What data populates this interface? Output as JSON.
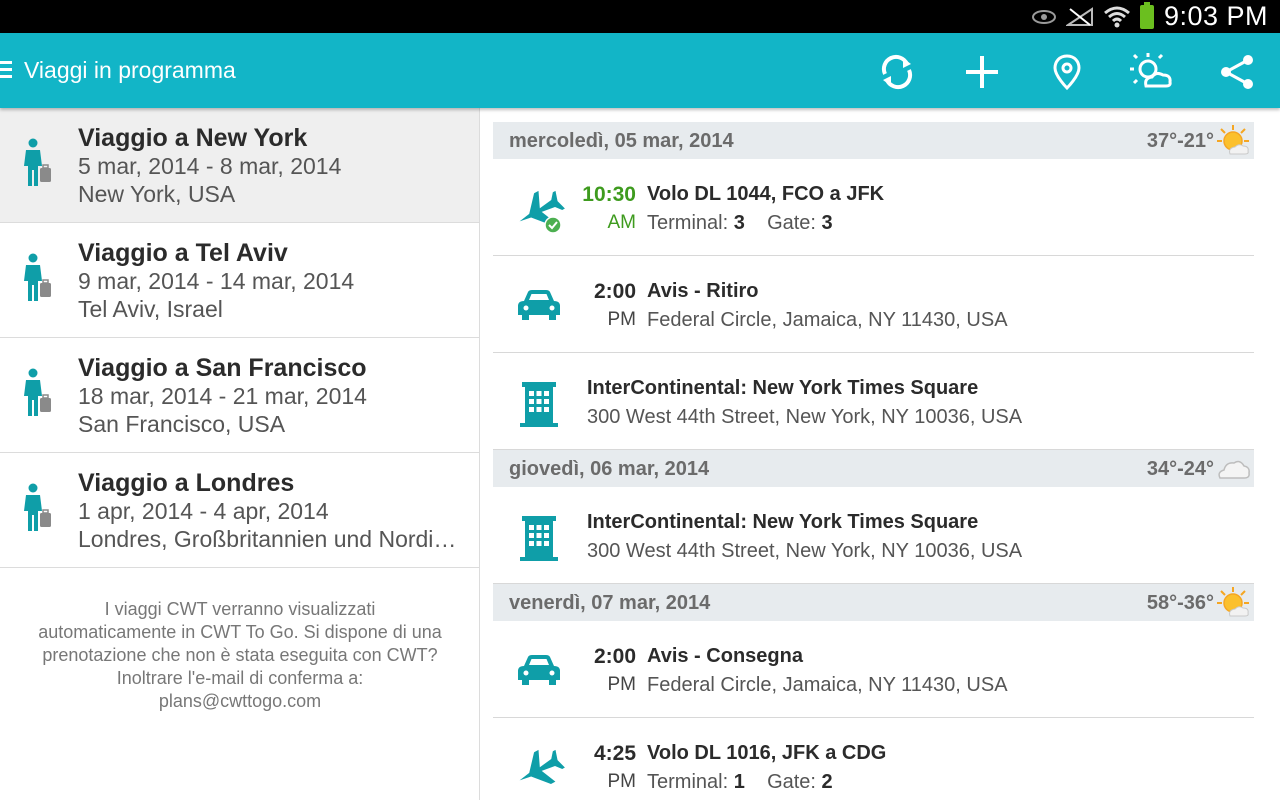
{
  "status_bar": {
    "time": "9:03 PM"
  },
  "action_bar": {
    "title": "Viaggi in programma",
    "actions": [
      "refresh-icon",
      "add-icon",
      "location-pin-icon",
      "weather-icon",
      "share-icon"
    ]
  },
  "trips": [
    {
      "name": "Viaggio a New York",
      "dates": "5 mar, 2014 - 8 mar, 2014",
      "place": "New York, USA"
    },
    {
      "name": "Viaggio a Tel Aviv",
      "dates": "9 mar, 2014 - 14 mar, 2014",
      "place": "Tel Aviv, Israel"
    },
    {
      "name": "Viaggio a San Francisco",
      "dates": "18 mar, 2014 - 21 mar, 2014",
      "place": "San Francisco, USA"
    },
    {
      "name": "Viaggio a Londres",
      "dates": "1 apr, 2014 - 4 apr, 2014",
      "place": "Londres, Großbritannien und Nordirland"
    }
  ],
  "footer_note": {
    "lines": [
      "I viaggi CWT verranno visualizzati",
      "automaticamente in CWT To Go. Si dispone di una",
      "prenotazione che non è stata eseguita con CWT?",
      "Inoltrare l'e-mail di conferma a:",
      "plans@cwttogo.com"
    ]
  },
  "itinerary": {
    "days": [
      {
        "label": "mercoledì, 05 mar, 2014",
        "temp": "37°-21°",
        "weather": "sunny-icon",
        "items": [
          {
            "type": "flight",
            "time": "10:30",
            "ampm": "AM",
            "title": "Volo DL 1044, FCO a JFK",
            "terminal_label": "Terminal:",
            "terminal": "3",
            "gate_label": "Gate:",
            "gate": "3"
          },
          {
            "type": "car",
            "time": "2:00",
            "ampm": "PM",
            "title": "Avis - Ritiro",
            "sub": "Federal Circle, Jamaica, NY 11430, USA"
          },
          {
            "type": "hotel",
            "title": "InterContinental: New York Times Square",
            "sub": "300 West 44th Street, New York, NY 10036, USA"
          }
        ]
      },
      {
        "label": "giovedì, 06 mar, 2014",
        "temp": "34°-24°",
        "weather": "cloudy-icon",
        "items": [
          {
            "type": "hotel",
            "title": "InterContinental: New York Times Square",
            "sub": "300 West 44th Street, New York, NY 10036, USA"
          }
        ]
      },
      {
        "label": "venerdì, 07 mar, 2014",
        "temp": "58°-36°",
        "weather": "sunny-icon",
        "items": [
          {
            "type": "car",
            "time": "2:00",
            "ampm": "PM",
            "title": "Avis - Consegna",
            "sub": "Federal Circle, Jamaica, NY 11430, USA"
          },
          {
            "type": "flight",
            "time": "4:25",
            "ampm": "PM",
            "title": "Volo DL 1016, JFK a CDG",
            "terminal_label": "Terminal:",
            "terminal": "1",
            "gate_label": "Gate:",
            "gate": "2"
          }
        ]
      }
    ]
  },
  "colors": {
    "accent": "#12b5c7",
    "teal_icon": "#0f9ea8",
    "green": "#3e9b1e",
    "header_bg": "#e7ebee"
  }
}
